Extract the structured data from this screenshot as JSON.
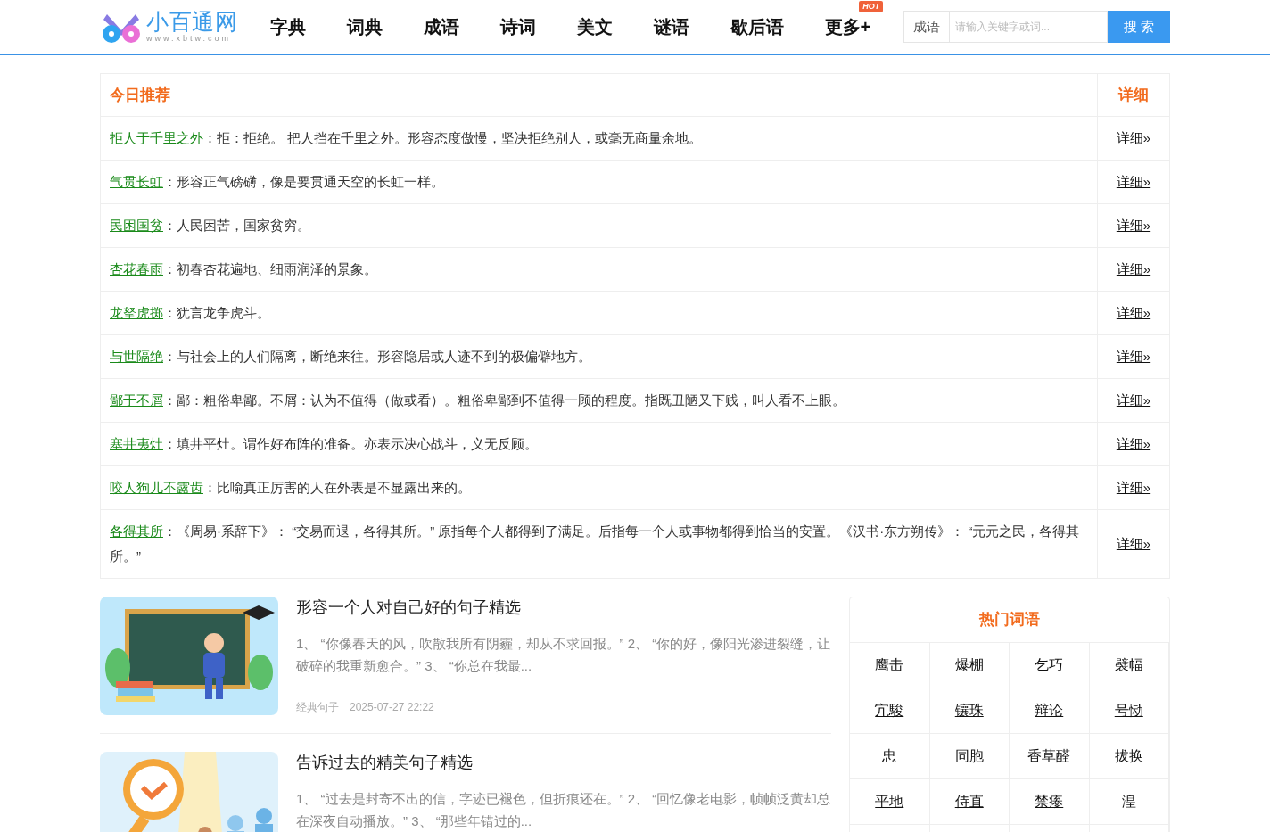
{
  "logo": {
    "name": "小百通网",
    "domain": "www.xbtw.com"
  },
  "nav": [
    {
      "label": "字典"
    },
    {
      "label": "词典"
    },
    {
      "label": "成语"
    },
    {
      "label": "诗词"
    },
    {
      "label": "美文"
    },
    {
      "label": "谜语"
    },
    {
      "label": "歇后语"
    },
    {
      "label": "更多+",
      "badge": "HOT"
    }
  ],
  "search": {
    "category": "成语",
    "placeholder": "请输入关键字或词...",
    "button": "搜 索"
  },
  "recommend": {
    "title": "今日推荐",
    "detail_heading": "详细",
    "rows": [
      {
        "word": "拒人于千里之外",
        "text": "：拒：拒绝。 把人挡在千里之外。形容态度傲慢，坚决拒绝别人，或毫无商量余地。",
        "link": "详细»"
      },
      {
        "word": "气贯长虹",
        "text": "：形容正气磅礴，像是要贯通天空的长虹一样。",
        "link": "详细»"
      },
      {
        "word": "民困国贫",
        "text": "：人民困苦，国家贫穷。",
        "link": "详细»"
      },
      {
        "word": "杏花春雨",
        "text": "：初春杏花遍地、细雨润泽的景象。",
        "link": "详细»"
      },
      {
        "word": "龙拏虎掷",
        "text": "：犹言龙争虎斗。",
        "link": "详细»"
      },
      {
        "word": "与世隔绝",
        "text": "：与社会上的人们隔离，断绝来往。形容隐居或人迹不到的极偏僻地方。",
        "link": "详细»"
      },
      {
        "word": "鄙于不屑",
        "text": "：鄙：粗俗卑鄙。不屑：认为不值得（做或看）。粗俗卑鄙到不值得一顾的程度。指既丑陋又下贱，叫人看不上眼。",
        "link": "详细»"
      },
      {
        "word": "塞井夷灶",
        "text": "：填井平灶。谓作好布阵的准备。亦表示决心战斗，义无反顾。",
        "link": "详细»"
      },
      {
        "word": "咬人狗儿不露齿",
        "text": "：比喻真正厉害的人在外表是不显露出来的。",
        "link": "详细»"
      },
      {
        "word": "各得其所",
        "text": "：《周易·系辞下》： “交易而退，各得其所。” 原指每个人都得到了满足。后指每一个人或事物都得到恰当的安置。《汉书·东方朔传》： “元元之民，各得其所。”",
        "link": "详细»"
      }
    ]
  },
  "articles": [
    {
      "kind": "picture",
      "title": "形容一个人对自己好的句子精选",
      "summary": "1、 “你像春天的风，吹散我所有阴霾，却从不求回报。” 2、 “你的好，像阳光渗进裂缝，让破碎的我重新愈合。” 3、 “你总在我最...",
      "category": "经典句子",
      "date": "2025-07-27 22:22"
    },
    {
      "kind": "picture",
      "title": "告诉过去的精美句子精选",
      "summary": "1、 “过去是封寄不出的信，字迹已褪色，但折痕还在。” 2、 “回忆像老电影，帧帧泛黄却总在深夜自动播放。” 3、 “那些年错过的..."
    }
  ],
  "hot_words": {
    "title": "热门词语",
    "words": [
      {
        "text": "鹰击",
        "underlined": true
      },
      {
        "text": "爆棚",
        "underlined": true
      },
      {
        "text": "乞巧",
        "underlined": true
      },
      {
        "text": "襞幅",
        "underlined": true
      },
      {
        "text": "宂駿",
        "underlined": true
      },
      {
        "text": "镶珠",
        "underlined": true
      },
      {
        "text": "辩论",
        "underlined": true
      },
      {
        "text": "号恸",
        "underlined": true
      },
      {
        "text": "忠",
        "underlined": false
      },
      {
        "text": "同胞",
        "underlined": true
      },
      {
        "text": "香草醛",
        "underlined": true
      },
      {
        "text": "拔换",
        "underlined": true
      },
      {
        "text": "平地",
        "underlined": true
      },
      {
        "text": "侍直",
        "underlined": true
      },
      {
        "text": "禁瘆",
        "underlined": true
      },
      {
        "text": "湟",
        "underlined": false
      }
    ]
  }
}
